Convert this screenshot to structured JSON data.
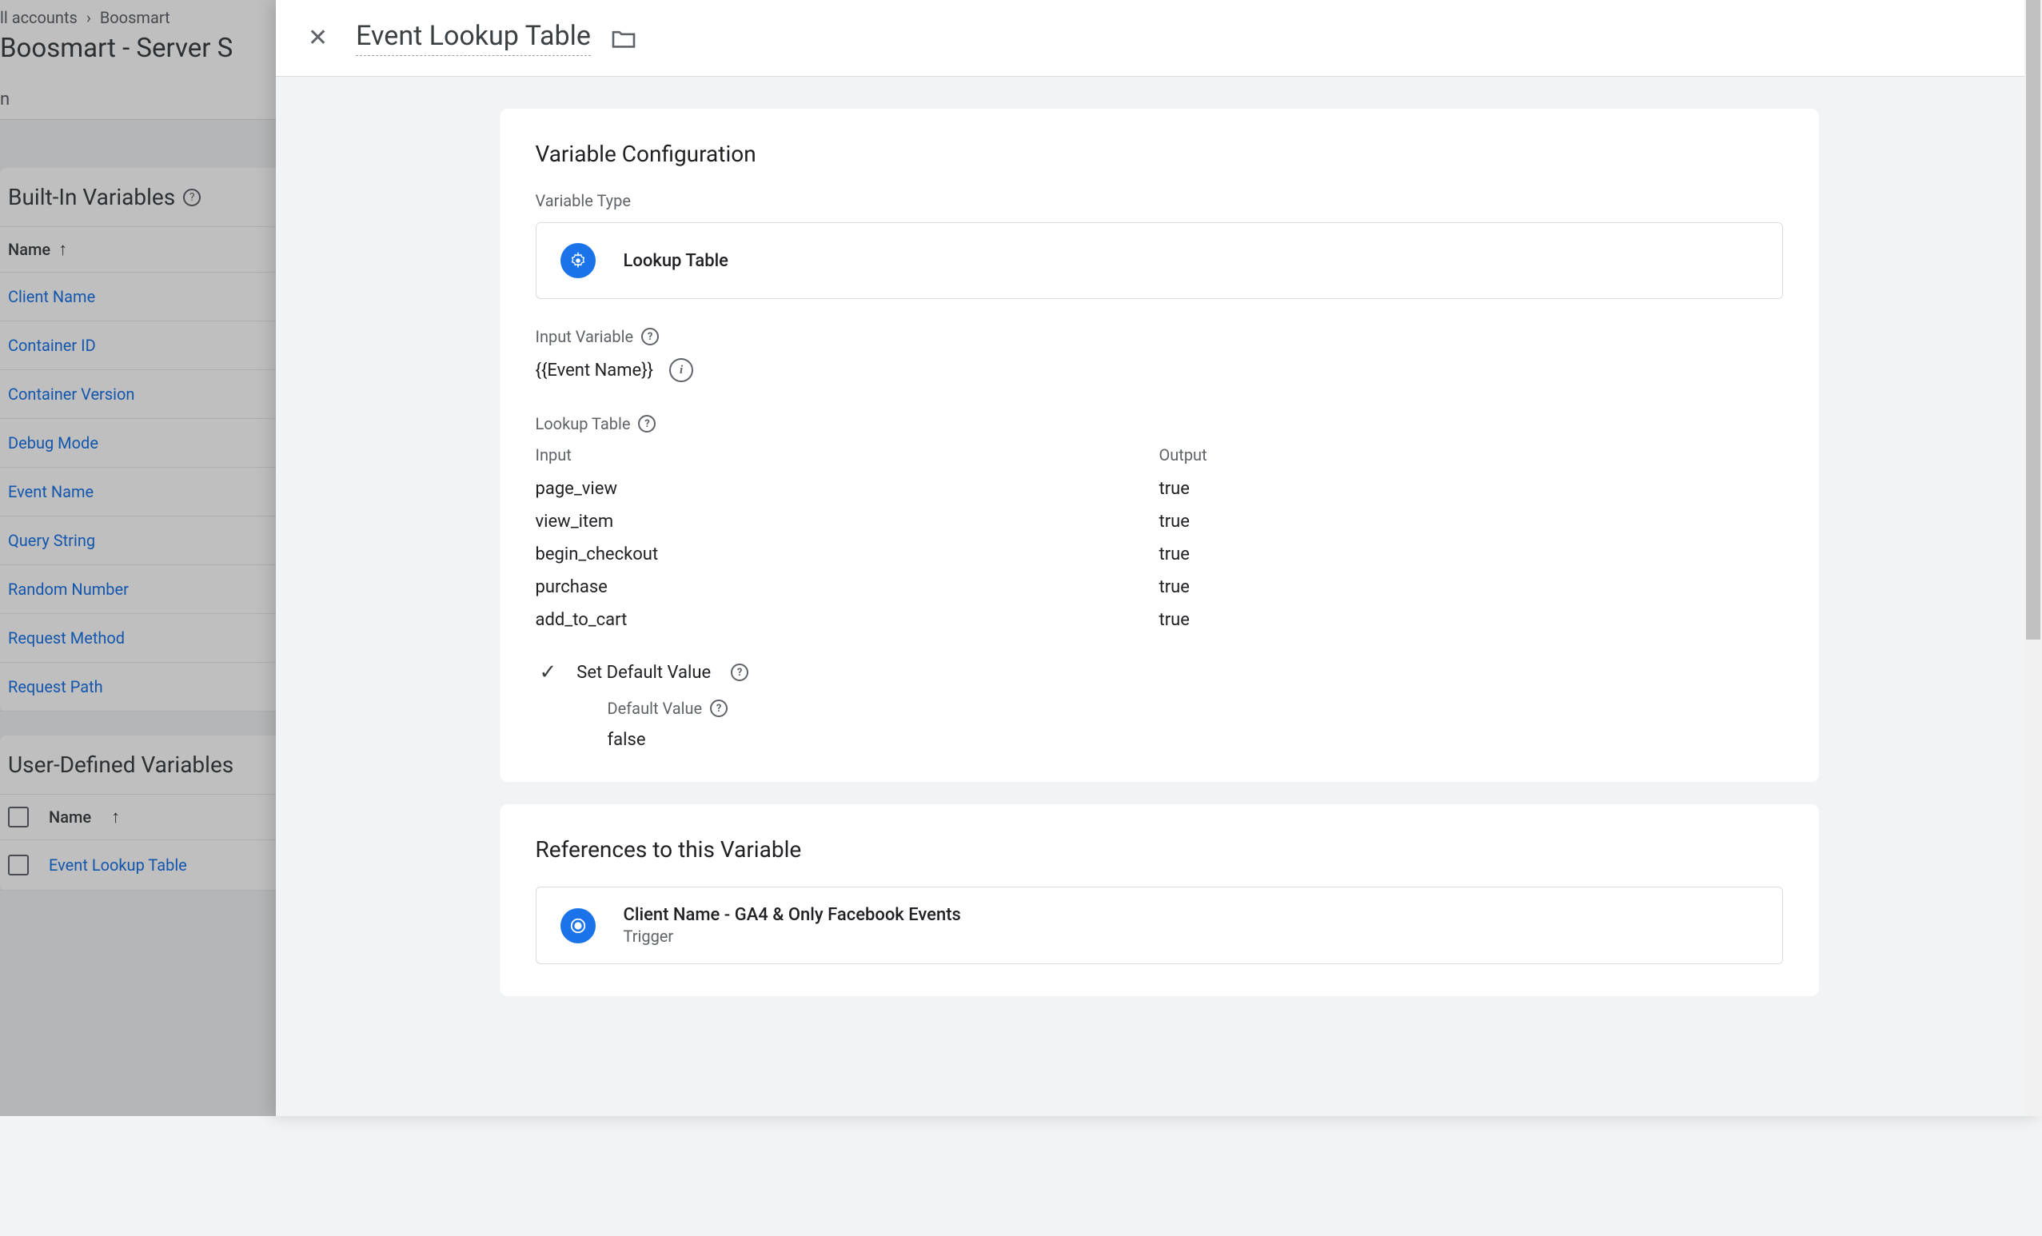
{
  "bg": {
    "breadcrumb1": "ll accounts",
    "breadcrumb2": "Boosmart",
    "title": "Boosmart - Server S",
    "tab": "n",
    "builtin_title": "Built-In Variables",
    "col_name": "Name",
    "builtin_vars": [
      "Client Name",
      "Container ID",
      "Container Version",
      "Debug Mode",
      "Event Name",
      "Query String",
      "Random Number",
      "Request Method",
      "Request Path"
    ],
    "userdef_title": "User-Defined Variables",
    "userdef_col": "Name",
    "userdef_vars": [
      "Event Lookup Table"
    ]
  },
  "modal": {
    "title": "Event Lookup Table",
    "config_title": "Variable Configuration",
    "var_type_label": "Variable Type",
    "var_type_name": "Lookup Table",
    "input_var_label": "Input Variable",
    "input_var_value": "{{Event Name}}",
    "lookup_label": "Lookup Table",
    "input_col": "Input",
    "output_col": "Output",
    "rows": [
      {
        "input": "page_view",
        "output": "true"
      },
      {
        "input": "view_item",
        "output": "true"
      },
      {
        "input": "begin_checkout",
        "output": "true"
      },
      {
        "input": "purchase",
        "output": "true"
      },
      {
        "input": "add_to_cart",
        "output": "true"
      }
    ],
    "set_default_label": "Set Default Value",
    "default_value_label": "Default Value",
    "default_value": "false",
    "references_title": "References to this Variable",
    "ref_name": "Client Name - GA4 & Only Facebook Events",
    "ref_type": "Trigger"
  }
}
